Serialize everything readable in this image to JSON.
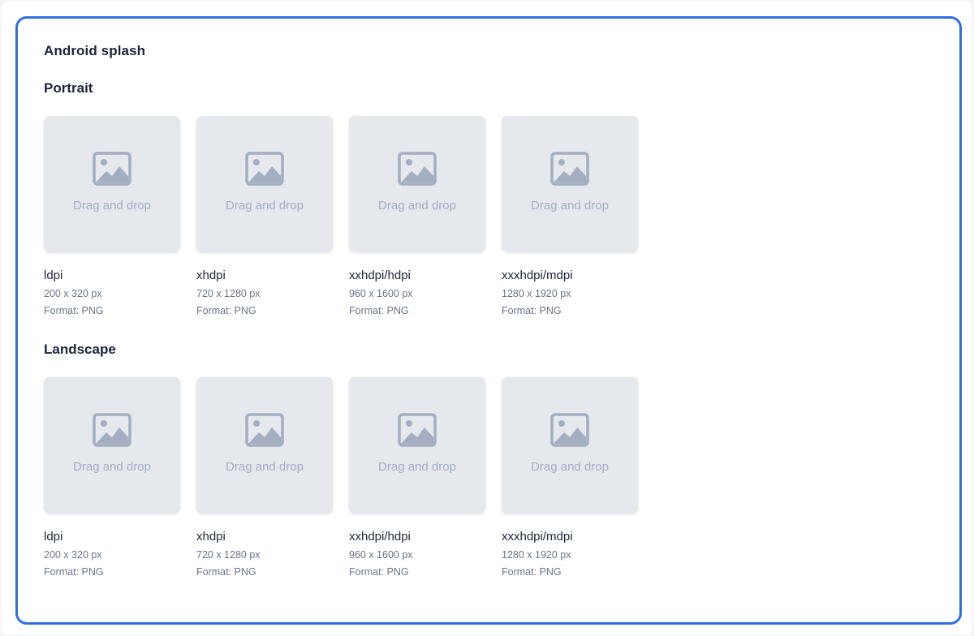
{
  "panel": {
    "title": "Android splash"
  },
  "sections": [
    {
      "title": "Portrait",
      "items": [
        {
          "name": "ldpi",
          "size": "200 x 320 px",
          "format": "Format: PNG",
          "drop_label": "Drag and drop"
        },
        {
          "name": "xhdpi",
          "size": "720 x 1280 px",
          "format": "Format: PNG",
          "drop_label": "Drag and drop"
        },
        {
          "name": "xxhdpi/hdpi",
          "size": "960 x 1600 px",
          "format": "Format: PNG",
          "drop_label": "Drag and drop"
        },
        {
          "name": "xxxhdpi/mdpi",
          "size": "1280 x 1920 px",
          "format": "Format: PNG",
          "drop_label": "Drag and drop"
        }
      ]
    },
    {
      "title": "Landscape",
      "items": [
        {
          "name": "ldpi",
          "size": "200 x 320 px",
          "format": "Format: PNG",
          "drop_label": "Drag and drop"
        },
        {
          "name": "xhdpi",
          "size": "720 x 1280 px",
          "format": "Format: PNG",
          "drop_label": "Drag and drop"
        },
        {
          "name": "xxhdpi/hdpi",
          "size": "960 x 1600 px",
          "format": "Format: PNG",
          "drop_label": "Drag and drop"
        },
        {
          "name": "xxxhdpi/mdpi",
          "size": "1280 x 1920 px",
          "format": "Format: PNG",
          "drop_label": "Drag and drop"
        }
      ]
    }
  ],
  "icons": {
    "placeholder": "image-icon"
  },
  "colors": {
    "accent_border": "#2f6fe0",
    "drop_background": "#e5e8ed",
    "icon_color": "#a3aec0",
    "heading_text": "#1c2436",
    "meta_text": "#6a7488"
  }
}
